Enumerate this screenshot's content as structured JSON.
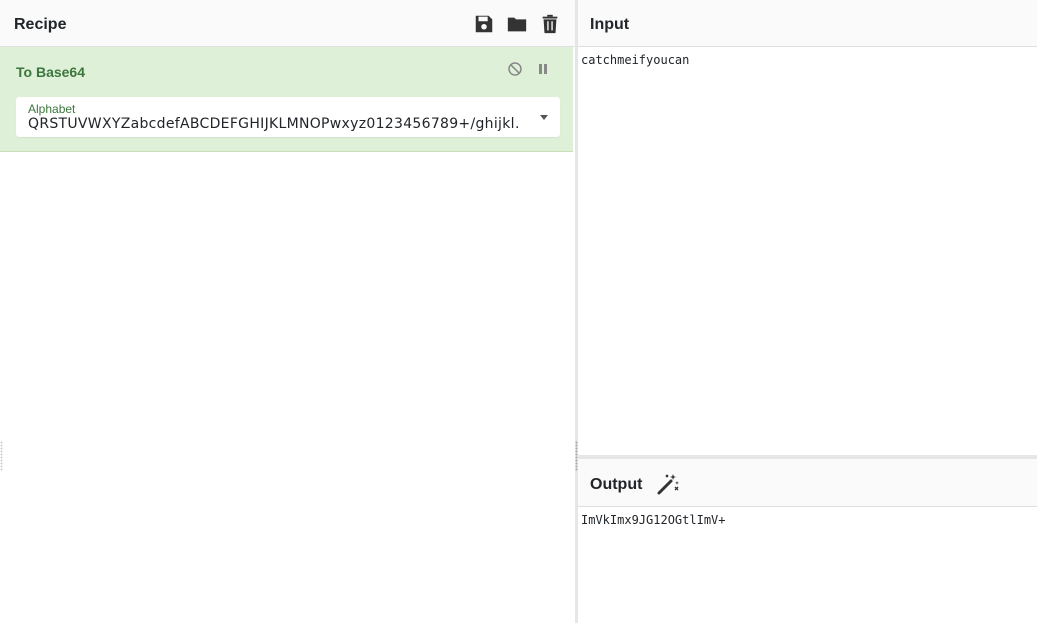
{
  "recipe": {
    "title": "Recipe",
    "operation": {
      "name": "To Base64",
      "argument": {
        "label": "Alphabet",
        "value": "QRSTUVWXYZabcdefABCDEFGHIJKLMNOPwxyz0123456789+/ghijkl…"
      }
    },
    "icons": [
      "save-icon",
      "folder-icon",
      "trash-icon"
    ]
  },
  "input": {
    "title": "Input",
    "text": "catchmeifyoucan"
  },
  "output": {
    "title": "Output",
    "text": "ImVkImx9JG12OGtlImV+"
  },
  "colors": {
    "operation_bg": "#dff0d8",
    "operation_text": "#3c763d",
    "header_bg": "#fafafa"
  }
}
